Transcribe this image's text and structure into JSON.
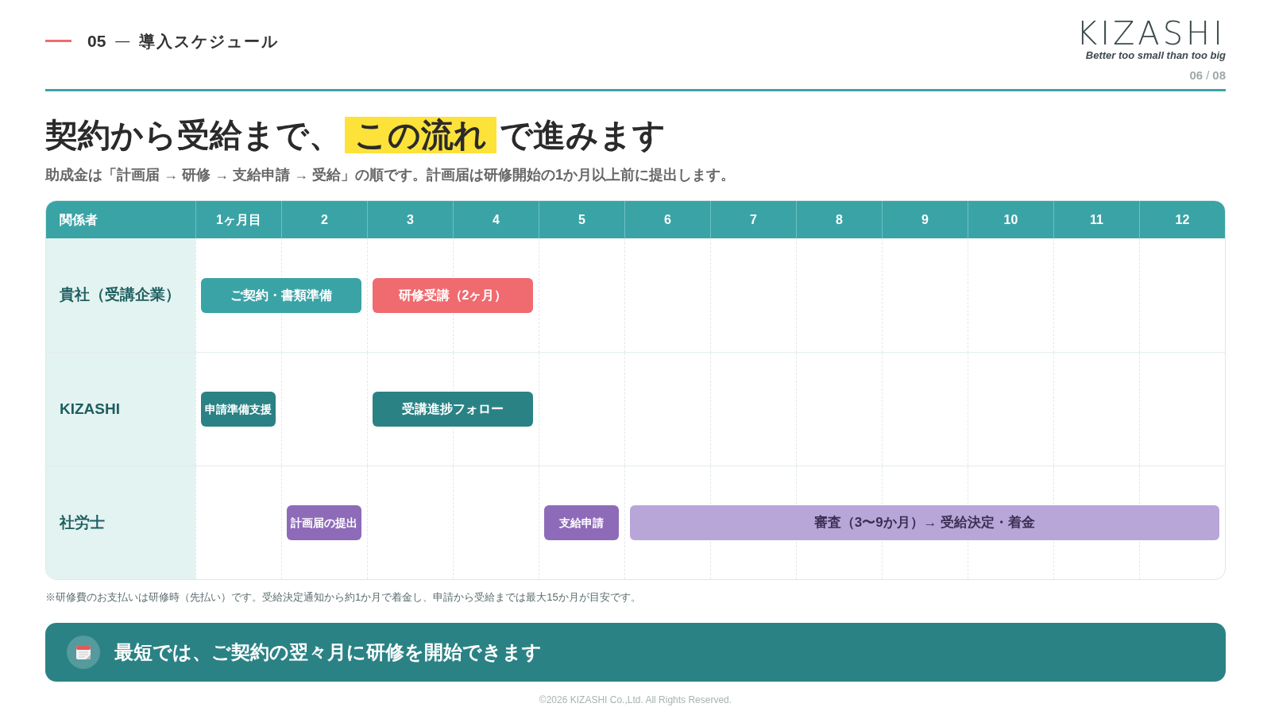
{
  "header": {
    "section_number": "05",
    "section_dash": "—",
    "section_title": "導入スケジュール",
    "logo": {
      "wordmark": "KIZASHI",
      "tagline": "Better too small than too big"
    },
    "page": {
      "current": "06",
      "separator": "/",
      "total": "08"
    }
  },
  "title": {
    "before": "契約から受給まで、",
    "highlight": "この流れ",
    "after": "で進みます"
  },
  "subtitle": "助成金は「計画届 → 研修 → 支給申請 → 受給」の順です。計画届は研修開始の1か月以上前に提出します。",
  "schedule": {
    "columns": [
      "関係者",
      "1ヶ月目",
      "2",
      "3",
      "4",
      "5",
      "6",
      "7",
      "8",
      "9",
      "10",
      "11",
      "12"
    ],
    "rows": [
      {
        "party": "貴社（受講企業）",
        "timeline": [
          {
            "kind": "bar",
            "label": "ご契約・書類準備",
            "color": "#3aa3a6"
          },
          {
            "kind": "continue"
          },
          {
            "kind": "bar",
            "label": "研修受講（2ヶ月）",
            "color": "#ef6b70"
          },
          {
            "kind": "continue"
          },
          {
            "kind": "empty"
          },
          {
            "kind": "empty"
          },
          {
            "kind": "empty"
          },
          {
            "kind": "empty"
          },
          {
            "kind": "empty"
          },
          {
            "kind": "empty"
          },
          {
            "kind": "empty"
          },
          {
            "kind": "empty"
          }
        ]
      },
      {
        "party": "KIZASHI",
        "timeline": [
          {
            "kind": "bar",
            "label": "申請準備支援",
            "color": "#2b8285"
          },
          {
            "kind": "empty"
          },
          {
            "kind": "bar",
            "label": "受講進捗フォロー",
            "color": "#2b8285"
          },
          {
            "kind": "continue"
          },
          {
            "kind": "empty"
          },
          {
            "kind": "empty"
          },
          {
            "kind": "empty"
          },
          {
            "kind": "empty"
          },
          {
            "kind": "empty"
          },
          {
            "kind": "empty"
          },
          {
            "kind": "empty"
          },
          {
            "kind": "empty"
          }
        ]
      },
      {
        "party": "社労士",
        "timeline": [
          {
            "kind": "empty"
          },
          {
            "kind": "bar",
            "label": "計画届の提出",
            "color": "#8e6bb8"
          },
          {
            "kind": "empty"
          },
          {
            "kind": "empty"
          },
          {
            "kind": "bar",
            "label": "支給申請",
            "color": "#8e6bb8"
          },
          {
            "kind": "soft_bar",
            "label": "審査（3〜9か月）→ 受給決定・着金",
            "color": "#b9a6d8"
          },
          {
            "kind": "continue"
          },
          {
            "kind": "continue"
          },
          {
            "kind": "continue"
          },
          {
            "kind": "continue"
          },
          {
            "kind": "continue"
          },
          {
            "kind": "continue"
          }
        ]
      }
    ]
  },
  "footnote": "※研修費のお支払いは研修時（先払い）です。受給決定通知から約1か月で着金し、申請から受給までは最大15か月が目安です。",
  "callout": "最短では、ご契約の翌々月に研修を開始できます",
  "copyright": "©2026 KIZASHI Co.,Ltd. All Rights Reserved."
}
